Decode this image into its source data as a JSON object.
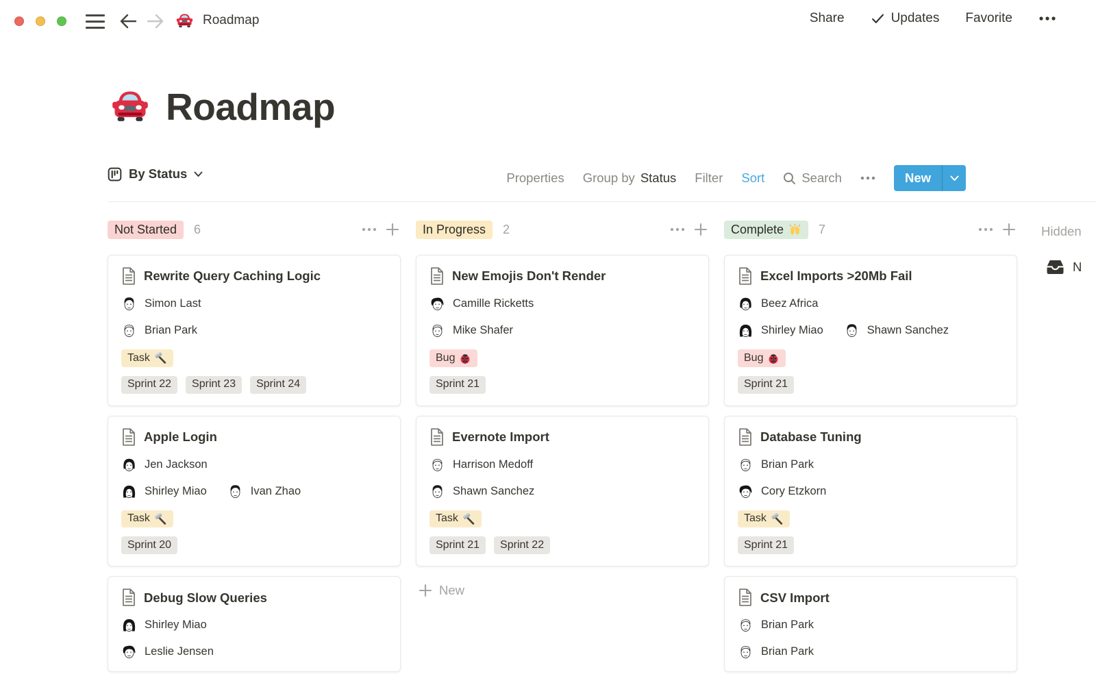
{
  "window": {
    "title": "Roadmap",
    "actions": {
      "share": "Share",
      "updates": "Updates",
      "favorite": "Favorite"
    }
  },
  "page": {
    "title": "Roadmap"
  },
  "toolbar": {
    "view_label": "By Status",
    "properties": "Properties",
    "group_by_prefix": "Group by",
    "group_by_value": "Status",
    "filter": "Filter",
    "sort": "Sort",
    "search": "Search",
    "new_label": "New"
  },
  "colors": {
    "accent_blue": "#3FA5DC",
    "status_red_bg": "#FAD4D2",
    "status_yellow_bg": "#FBEAC2",
    "status_green_bg": "#DBEBDC",
    "tag_yellow_bg": "#FAEBC8",
    "tag_red_bg": "#FBD9D7",
    "tag_gray_bg": "#E7E6E2"
  },
  "board": {
    "hidden_label": "Hidden",
    "hidden_item_label": "N",
    "new_card_label": "New",
    "columns": [
      {
        "name": "Not Started",
        "emoji": null,
        "color": "red",
        "count": "6",
        "show_new": false,
        "cards": [
          {
            "title": "Rewrite Query Caching Logic",
            "people": [
              [
                {
                  "name": "Simon Last",
                  "avatar": "man-dark"
                }
              ],
              [
                {
                  "name": "Brian Park",
                  "avatar": "man-light"
                }
              ]
            ],
            "tags": [
              {
                "label": "Task",
                "icon": "hammer",
                "color": "yellow"
              }
            ],
            "sprints": [
              "Sprint 22",
              "Sprint 23",
              "Sprint 24"
            ]
          },
          {
            "title": "Apple Login",
            "people": [
              [
                {
                  "name": "Jen Jackson",
                  "avatar": "woman-bob"
                }
              ],
              [
                {
                  "name": "Shirley Miao",
                  "avatar": "woman-long"
                },
                {
                  "name": "Ivan Zhao",
                  "avatar": "man-dark"
                }
              ]
            ],
            "tags": [
              {
                "label": "Task",
                "icon": "hammer",
                "color": "yellow"
              }
            ],
            "sprints": [
              "Sprint 20"
            ]
          },
          {
            "title": "Debug Slow Queries",
            "people": [
              [
                {
                  "name": "Shirley Miao",
                  "avatar": "woman-long"
                }
              ],
              [
                {
                  "name": "Leslie Jensen",
                  "avatar": "woman-curly"
                }
              ]
            ],
            "tags": [],
            "sprints": []
          }
        ]
      },
      {
        "name": "In Progress",
        "emoji": null,
        "color": "yellow",
        "count": "2",
        "show_new": true,
        "cards": [
          {
            "title": "New Emojis Don't Render",
            "people": [
              [
                {
                  "name": "Camille Ricketts",
                  "avatar": "woman-curly"
                }
              ],
              [
                {
                  "name": "Mike Shafer",
                  "avatar": "man-light"
                }
              ]
            ],
            "tags": [
              {
                "label": "Bug",
                "icon": "bug",
                "color": "red"
              }
            ],
            "sprints": [
              "Sprint 21"
            ]
          },
          {
            "title": "Evernote Import",
            "people": [
              [
                {
                  "name": "Harrison Medoff",
                  "avatar": "man-light"
                }
              ],
              [
                {
                  "name": "Shawn Sanchez",
                  "avatar": "man-dark"
                }
              ]
            ],
            "tags": [
              {
                "label": "Task",
                "icon": "hammer",
                "color": "yellow"
              }
            ],
            "sprints": [
              "Sprint 21",
              "Sprint 22"
            ]
          }
        ]
      },
      {
        "name": "Complete",
        "emoji": "raised-hands",
        "color": "green",
        "count": "7",
        "show_new": false,
        "cards": [
          {
            "title": "Excel Imports >20Mb Fail",
            "people": [
              [
                {
                  "name": "Beez Africa",
                  "avatar": "woman-bob"
                }
              ],
              [
                {
                  "name": "Shirley Miao",
                  "avatar": "woman-long"
                },
                {
                  "name": "Shawn Sanchez",
                  "avatar": "man-dark"
                }
              ]
            ],
            "tags": [
              {
                "label": "Bug",
                "icon": "bug",
                "color": "red"
              }
            ],
            "sprints": [
              "Sprint 21"
            ]
          },
          {
            "title": "Database Tuning",
            "people": [
              [
                {
                  "name": "Brian Park",
                  "avatar": "man-light"
                }
              ],
              [
                {
                  "name": "Cory Etzkorn",
                  "avatar": "woman-curly"
                }
              ]
            ],
            "tags": [
              {
                "label": "Task",
                "icon": "hammer",
                "color": "yellow"
              }
            ],
            "sprints": [
              "Sprint 21"
            ]
          },
          {
            "title": "CSV Import",
            "people": [
              [
                {
                  "name": "Brian Park",
                  "avatar": "man-light"
                }
              ],
              [
                {
                  "name": "Brian Park",
                  "avatar": "man-light"
                }
              ]
            ],
            "tags": [],
            "sprints": []
          }
        ]
      }
    ]
  }
}
